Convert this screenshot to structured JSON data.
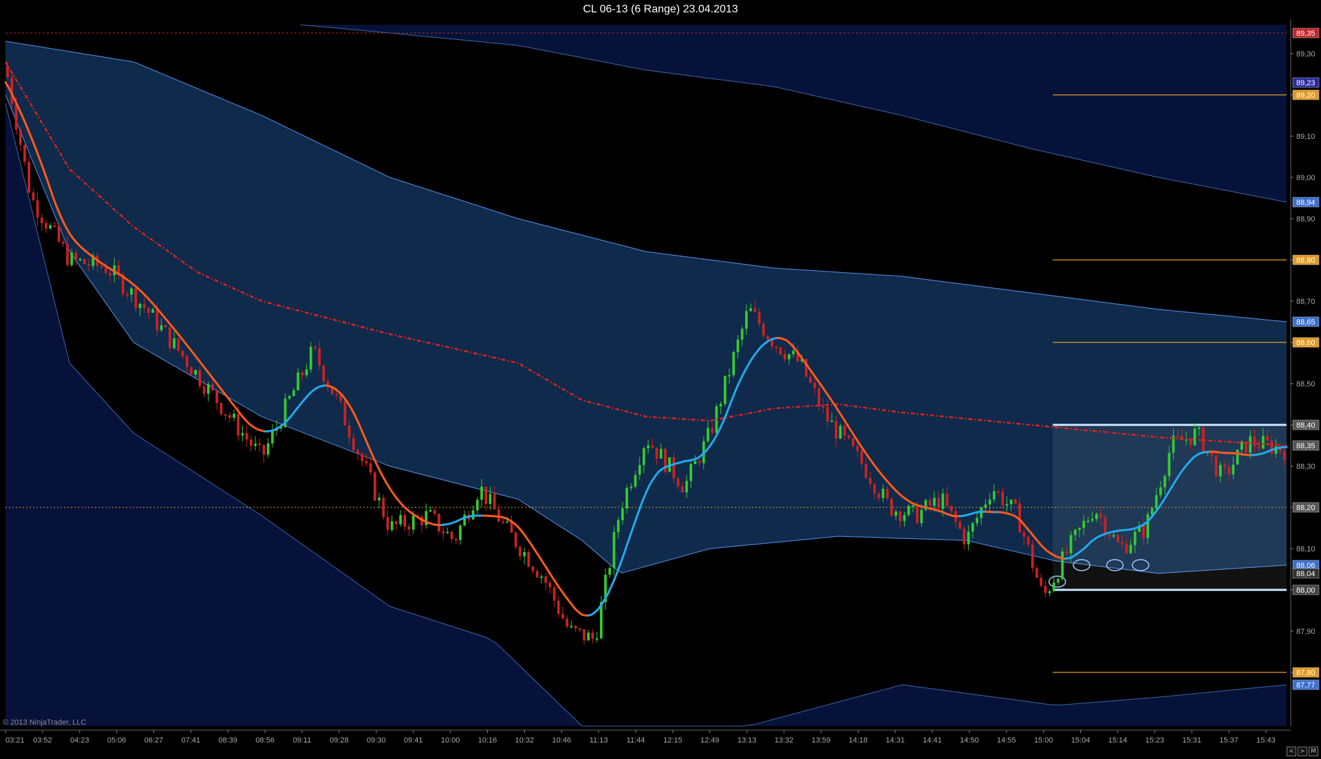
{
  "window": {
    "title": "CL 06-13 (6 Range)  23.04.2013"
  },
  "copyright": "© 2013 NinjaTrader, LLC",
  "colors": {
    "background": "#000000",
    "up_bar": "#33cc33",
    "down_bar": "#cc2222",
    "fast_ma_down": "#ff5a1e",
    "fast_ma_up": "#22aaee",
    "slow_ma": "#dd2222",
    "band_inner": "#0f2a4a",
    "band_outer": "#07123a",
    "band_line": "#4a7fd0",
    "level_line": "#e6a12a",
    "range_box": "#cfe8ff"
  },
  "chart_data": {
    "type": "candlestick",
    "instrument": "CL 06-13",
    "bar_type": "6 Range",
    "date": "23.04.2013",
    "ylim": [
      87.67,
      89.37
    ],
    "y_ticks": [
      "89,30",
      "89,20",
      "89,10",
      "89,00",
      "88,90",
      "88,80",
      "88,70",
      "88,60",
      "88,50",
      "88,40",
      "88,30",
      "88,20",
      "88,10",
      "88,00",
      "87,90",
      "87,80"
    ],
    "x_ticks": [
      "03:21",
      "03:52",
      "04:23",
      "05:06",
      "06:27",
      "07:41",
      "08:39",
      "08:56",
      "09:11",
      "09:28",
      "09:30",
      "09:41",
      "10:00",
      "10:16",
      "10:32",
      "10:46",
      "11:13",
      "11:44",
      "12:15",
      "12:49",
      "13:13",
      "13:32",
      "13:59",
      "14:18",
      "14:31",
      "14:41",
      "14:50",
      "14:55",
      "15:00",
      "15:04",
      "15:14",
      "15:23",
      "15:31",
      "15:37",
      "15:43"
    ],
    "price_markers": [
      {
        "value": 89.35,
        "label": "89,35",
        "color": "#c0262b"
      },
      {
        "value": 89.23,
        "label": "89,23",
        "color": "#2a2aa0"
      },
      {
        "value": 89.2,
        "label": "89,20",
        "color": "#e09a24"
      },
      {
        "value": 88.94,
        "label": "88,94",
        "color": "#3d6fd0"
      },
      {
        "value": 88.8,
        "label": "88,80",
        "color": "#e09a24"
      },
      {
        "value": 88.65,
        "label": "88,65",
        "color": "#3d6fd0"
      },
      {
        "value": 88.6,
        "label": "88,60",
        "color": "#e09a24"
      },
      {
        "value": 88.4,
        "label": "88,40",
        "color": "#555555"
      },
      {
        "value": 88.35,
        "label": "88,35",
        "color": "#555555"
      },
      {
        "value": 88.2,
        "label": "88,20",
        "color": "#555555"
      },
      {
        "value": 88.06,
        "label": "88,06",
        "color": "#3d6fd0"
      },
      {
        "value": 88.04,
        "label": "88,04",
        "color": "#333333"
      },
      {
        "value": 88.0,
        "label": "88,00",
        "color": "#444444"
      },
      {
        "value": 87.8,
        "label": "87,80",
        "color": "#e09a24"
      },
      {
        "value": 87.77,
        "label": "87,77",
        "color": "#3d6fd0"
      }
    ],
    "horizontal_levels": {
      "dotted_high": 89.35,
      "dotted_mid": 88.2,
      "orange_levels": [
        89.2,
        88.8,
        88.6,
        87.8
      ],
      "range_box": {
        "top": 88.4,
        "bottom": 88.0,
        "from": "15:00"
      }
    },
    "price_path": [
      [
        0,
        89.27
      ],
      [
        0.02,
        88.95
      ],
      [
        0.05,
        88.8
      ],
      [
        0.08,
        88.78
      ],
      [
        0.11,
        88.68
      ],
      [
        0.15,
        88.52
      ],
      [
        0.2,
        88.32
      ],
      [
        0.22,
        88.45
      ],
      [
        0.24,
        88.58
      ],
      [
        0.26,
        88.45
      ],
      [
        0.28,
        88.3
      ],
      [
        0.3,
        88.15
      ],
      [
        0.33,
        88.18
      ],
      [
        0.35,
        88.12
      ],
      [
        0.37,
        88.25
      ],
      [
        0.39,
        88.15
      ],
      [
        0.42,
        88.03
      ],
      [
        0.44,
        87.9
      ],
      [
        0.46,
        87.88
      ],
      [
        0.48,
        88.2
      ],
      [
        0.5,
        88.37
      ],
      [
        0.53,
        88.25
      ],
      [
        0.55,
        88.38
      ],
      [
        0.58,
        88.68
      ],
      [
        0.6,
        88.6
      ],
      [
        0.62,
        88.55
      ],
      [
        0.64,
        88.42
      ],
      [
        0.67,
        88.3
      ],
      [
        0.69,
        88.2
      ],
      [
        0.71,
        88.18
      ],
      [
        0.73,
        88.22
      ],
      [
        0.75,
        88.12
      ],
      [
        0.77,
        88.25
      ],
      [
        0.79,
        88.18
      ],
      [
        0.81,
        87.98
      ],
      [
        0.83,
        88.1
      ],
      [
        0.85,
        88.2
      ],
      [
        0.87,
        88.1
      ],
      [
        0.89,
        88.15
      ],
      [
        0.91,
        88.35
      ],
      [
        0.93,
        88.38
      ],
      [
        0.95,
        88.27
      ],
      [
        0.97,
        88.36
      ],
      [
        1.0,
        88.34
      ]
    ],
    "slow_ma_path": [
      [
        0,
        89.28
      ],
      [
        0.05,
        89.02
      ],
      [
        0.1,
        88.88
      ],
      [
        0.15,
        88.77
      ],
      [
        0.2,
        88.7
      ],
      [
        0.3,
        88.62
      ],
      [
        0.4,
        88.55
      ],
      [
        0.45,
        88.46
      ],
      [
        0.5,
        88.42
      ],
      [
        0.55,
        88.41
      ],
      [
        0.6,
        88.44
      ],
      [
        0.65,
        88.45
      ],
      [
        0.7,
        88.43
      ],
      [
        0.8,
        88.4
      ],
      [
        0.9,
        88.37
      ],
      [
        1.0,
        88.35
      ]
    ],
    "band_upper_path": [
      [
        0,
        89.33
      ],
      [
        0.1,
        89.28
      ],
      [
        0.2,
        89.15
      ],
      [
        0.3,
        89.0
      ],
      [
        0.4,
        88.9
      ],
      [
        0.5,
        88.82
      ],
      [
        0.6,
        88.78
      ],
      [
        0.7,
        88.76
      ],
      [
        0.8,
        88.72
      ],
      [
        0.9,
        88.68
      ],
      [
        1.0,
        88.65
      ]
    ],
    "band_lower_path": [
      [
        0,
        89.2
      ],
      [
        0.05,
        88.82
      ],
      [
        0.1,
        88.6
      ],
      [
        0.2,
        88.42
      ],
      [
        0.3,
        88.3
      ],
      [
        0.4,
        88.22
      ],
      [
        0.45,
        88.12
      ],
      [
        0.48,
        88.04
      ],
      [
        0.55,
        88.1
      ],
      [
        0.65,
        88.13
      ],
      [
        0.75,
        88.12
      ],
      [
        0.82,
        88.07
      ],
      [
        0.9,
        88.04
      ],
      [
        1.0,
        88.06
      ]
    ],
    "outer_upper_path": [
      [
        0.23,
        89.37
      ],
      [
        0.3,
        89.35
      ],
      [
        0.4,
        89.32
      ],
      [
        0.5,
        89.26
      ],
      [
        0.6,
        89.22
      ],
      [
        0.7,
        89.15
      ],
      [
        0.8,
        89.07
      ],
      [
        0.9,
        89.0
      ],
      [
        1.0,
        88.94
      ]
    ],
    "outer_lower_path": [
      [
        0,
        89.18
      ],
      [
        0.05,
        88.55
      ],
      [
        0.1,
        88.38
      ],
      [
        0.2,
        88.18
      ],
      [
        0.3,
        87.96
      ],
      [
        0.38,
        87.88
      ],
      [
        0.45,
        87.67
      ],
      [
        0.58,
        87.67
      ],
      [
        0.7,
        87.77
      ],
      [
        0.82,
        87.72
      ],
      [
        0.9,
        87.74
      ],
      [
        1.0,
        87.77
      ]
    ]
  }
}
